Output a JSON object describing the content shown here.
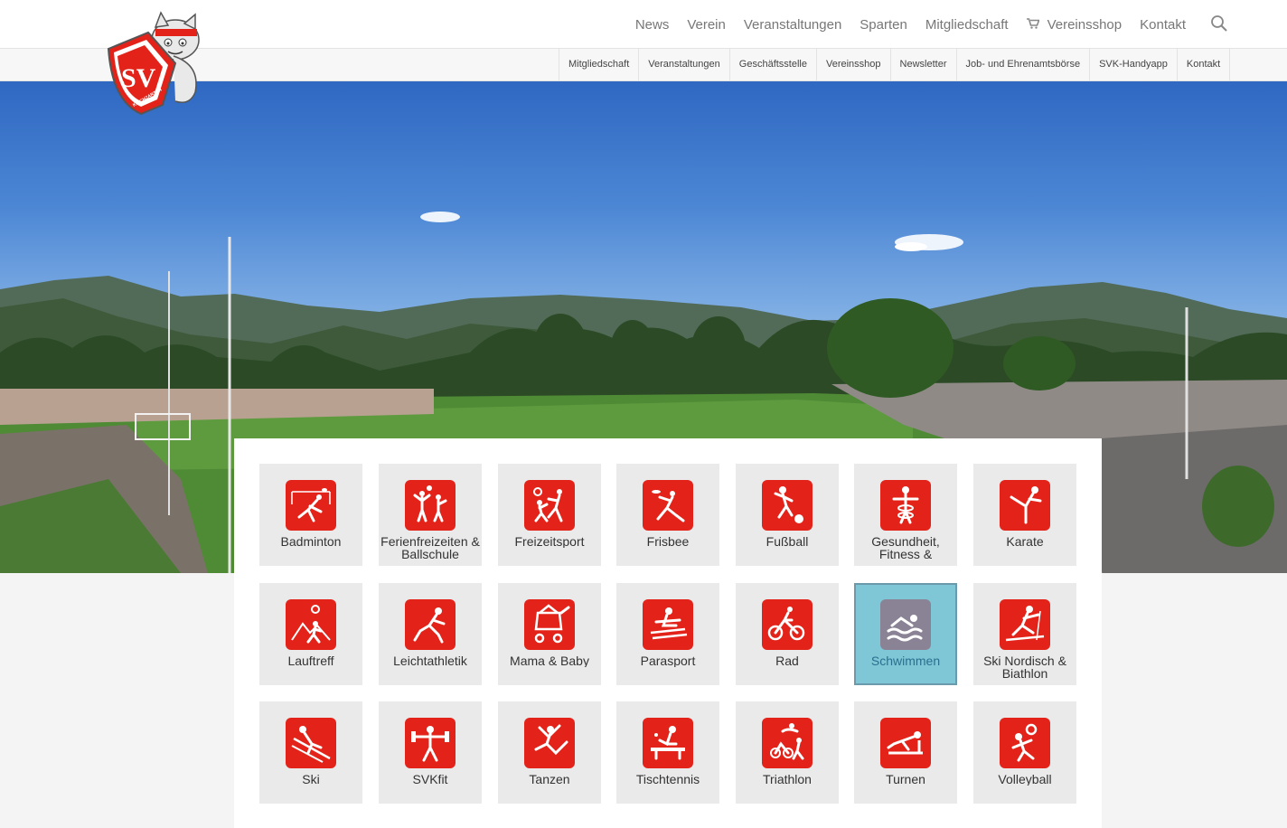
{
  "header": {
    "main_nav": [
      "News",
      "Verein",
      "Veranstaltungen",
      "Sparten",
      "Mitgliedschaft",
      "Vereinsshop",
      "Kontakt"
    ],
    "cart_item": "Vereinsshop"
  },
  "subheader": {
    "sub_nav": [
      "Mitgliedschaft",
      "Veranstaltungen",
      "Geschäftsstelle",
      "Vereinsshop",
      "Newsletter",
      "Job- und Ehrenamtsbörse",
      "SVK-Handyapp",
      "Kontakt"
    ]
  },
  "logo": {
    "text": "SV",
    "subtext": "KIRCHZARTEN"
  },
  "colors": {
    "brand_red": "#e3231a",
    "active_tile": "#7fc6d6",
    "active_icon": "#8a8396"
  },
  "tiles": [
    {
      "label": "Badminton",
      "icon": "badminton-icon"
    },
    {
      "label": "Ferienfreizeiten & Ballschule",
      "icon": "ferienfreizeiten-icon"
    },
    {
      "label": "Freizeitsport",
      "icon": "freizeitsport-icon"
    },
    {
      "label": "Frisbee",
      "icon": "frisbee-icon"
    },
    {
      "label": "Fußball",
      "icon": "fussball-icon"
    },
    {
      "label": "Gesundheit, Fitness & Rehasport",
      "icon": "gesundheit-icon"
    },
    {
      "label": "Karate",
      "icon": "karate-icon"
    },
    {
      "label": "Lauftreff",
      "icon": "lauftreff-icon"
    },
    {
      "label": "Leichtathletik",
      "icon": "leichtathletik-icon"
    },
    {
      "label": "Mama & Baby",
      "icon": "mama-baby-icon"
    },
    {
      "label": "Parasport",
      "icon": "parasport-icon"
    },
    {
      "label": "Rad",
      "icon": "rad-icon"
    },
    {
      "label": "Schwimmen",
      "icon": "schwimmen-icon",
      "active": true
    },
    {
      "label": "Ski Nordisch & Biathlon",
      "icon": "ski-nordisch-icon"
    },
    {
      "label": "Ski",
      "icon": "ski-icon"
    },
    {
      "label": "SVKfit",
      "icon": "svkfit-icon"
    },
    {
      "label": "Tanzen",
      "icon": "tanzen-icon"
    },
    {
      "label": "Tischtennis",
      "icon": "tischtennis-icon"
    },
    {
      "label": "Triathlon",
      "icon": "triathlon-icon"
    },
    {
      "label": "Turnen",
      "icon": "turnen-icon"
    },
    {
      "label": "Volleyball",
      "icon": "volleyball-icon"
    }
  ]
}
